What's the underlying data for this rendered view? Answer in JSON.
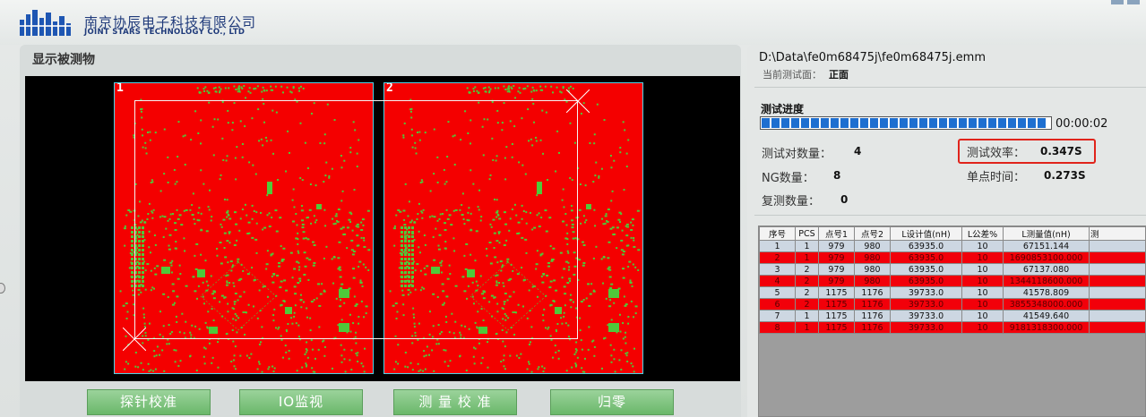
{
  "header": {
    "logo_icon": "company-logo-icon",
    "company_cn": "南京协辰电子科技有限公司",
    "company_en": "JOINT STARS TECHNOLOGY CO., LTD"
  },
  "left_panel": {
    "title": "显示被测物",
    "board_labels": [
      "1",
      "2"
    ],
    "buttons": {
      "probe_calib": "探针校准",
      "io_monitor": "IO监视",
      "measure_calib": "测 量 校 准",
      "zero": "归零"
    }
  },
  "right_panel": {
    "file_path": "D:\\Data\\fe0m68475j\\fe0m68475j.emm",
    "face_label": "当前测试面：",
    "face_value": "正面",
    "progress_title": "测试进度",
    "progress_fraction": 0.98,
    "progress_time": "00:00:02",
    "stats": {
      "pair_count_label": "测试对数量：",
      "pair_count_value": "4",
      "efficiency_label": "测试效率：",
      "efficiency_value": "0.347S",
      "ng_count_label": "NG数量：",
      "ng_count_value": "8",
      "point_time_label": "单点时间：",
      "point_time_value": "0.273S",
      "retest_count_label": "复测数量：",
      "retest_count_value": "0"
    },
    "table": {
      "headers": [
        "序号",
        "PCS",
        "点号1",
        "点号2",
        "L设计值(nH)",
        "L公差%",
        "L测量值(nH)",
        "测"
      ],
      "rows": [
        {
          "status": "ok",
          "cells": [
            "1",
            "1",
            "979",
            "980",
            "63935.0",
            "10",
            "67151.144",
            ""
          ]
        },
        {
          "status": "ng",
          "cells": [
            "2",
            "1",
            "979",
            "980",
            "63935.0",
            "10",
            "1690853100.000",
            ""
          ]
        },
        {
          "status": "ok",
          "cells": [
            "3",
            "2",
            "979",
            "980",
            "63935.0",
            "10",
            "67137.080",
            ""
          ]
        },
        {
          "status": "ng",
          "cells": [
            "4",
            "2",
            "979",
            "980",
            "63935.0",
            "10",
            "1344118600.000",
            ""
          ]
        },
        {
          "status": "ok",
          "cells": [
            "5",
            "2",
            "1175",
            "1176",
            "39733.0",
            "10",
            "41578.809",
            ""
          ]
        },
        {
          "status": "ng",
          "cells": [
            "6",
            "2",
            "1175",
            "1176",
            "39733.0",
            "10",
            "3855348000.000",
            ""
          ]
        },
        {
          "status": "ok",
          "cells": [
            "7",
            "1",
            "1175",
            "1176",
            "39733.0",
            "10",
            "41549.640",
            ""
          ]
        },
        {
          "status": "ng",
          "cells": [
            "8",
            "1",
            "1175",
            "1176",
            "39733.0",
            "10",
            "9181318300.000",
            ""
          ]
        }
      ]
    }
  },
  "colors": {
    "board_red": "#f40000",
    "board_border": "#4fd4e8",
    "pad_green": "#4ec93a",
    "progress_blue": "#1e6fd0",
    "button_green": "#7cc47c",
    "highlight_red": "#e0241b",
    "ng_row": "#f2000a",
    "ok_row": "#cdd7e2"
  }
}
